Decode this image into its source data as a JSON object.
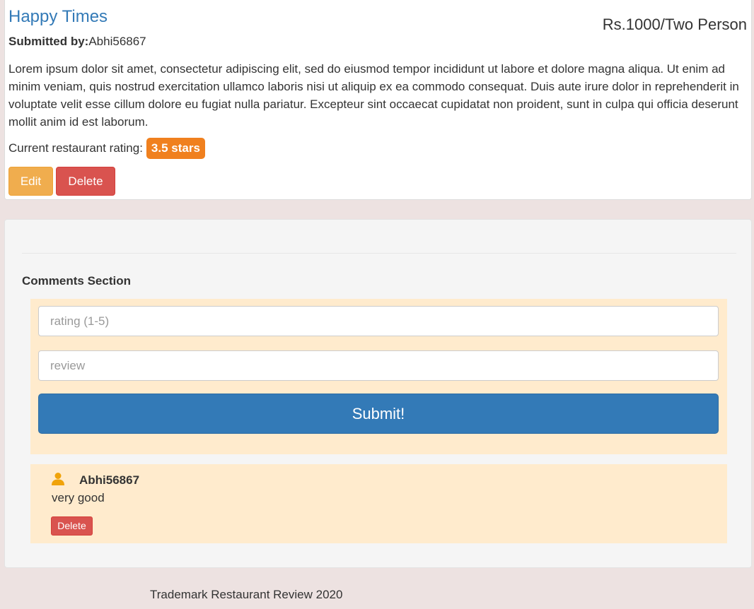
{
  "restaurant": {
    "name": "Happy Times",
    "price": "Rs.1000/Two Person",
    "submitted_label": "Submitted by:",
    "submitted_by": "Abhi56867",
    "description": "Lorem ipsum dolor sit amet, consectetur adipiscing elit, sed do eiusmod tempor incididunt ut labore et dolore magna aliqua. Ut enim ad minim veniam, quis nostrud exercitation ullamco laboris nisi ut aliquip ex ea commodo consequat. Duis aute irure dolor in reprehenderit in voluptate velit esse cillum dolore eu fugiat nulla pariatur. Excepteur sint occaecat cupidatat non proident, sunt in culpa qui officia deserunt mollit anim id est laborum.",
    "rating_label": "Current restaurant rating:",
    "rating_badge": "3.5 stars",
    "edit_label": "Edit",
    "delete_label": "Delete"
  },
  "comments": {
    "heading": "Comments Section",
    "form": {
      "rating_placeholder": "rating (1-5)",
      "review_placeholder": "review",
      "submit_label": "Submit!"
    },
    "items": [
      {
        "icon": "user-icon",
        "author": "Abhi56867",
        "text": "very good",
        "delete_label": "Delete"
      }
    ]
  },
  "footer": {
    "text": "Trademark Restaurant Review 2020"
  },
  "colors": {
    "background": "#ede2e1",
    "link": "#337ab7",
    "badge": "#f0801e",
    "edit": "#f0ad4e",
    "danger": "#d9534f",
    "panel": "#ffebcd",
    "user_icon": "#f0a30a"
  }
}
